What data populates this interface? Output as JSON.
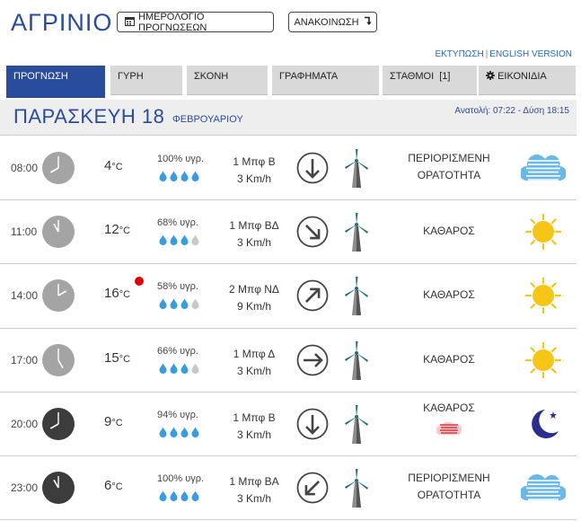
{
  "header": {
    "city": "ΑΓΡΙΝΙΟ",
    "calendar_button": "ΗΜΕΡΟΛΟΓΙΟ ΠΡΟΓΝΩΣΕΩΝ",
    "announcement_button": "ΑΝΑΚΟΙΝΩΣΗ",
    "print_link": "ΕΚΤΥΠΩΣΗ",
    "english_link": "ENGLISH VERSION"
  },
  "tabs": [
    {
      "label": "ΠΡΟΓΝΩΣΗ",
      "active": true
    },
    {
      "label": "ΓΥΡΗ",
      "active": false
    },
    {
      "label": "ΣΚΟΝΗ",
      "active": false
    },
    {
      "label": "ΓΡΑΦΗΜΑΤΑ",
      "active": false
    },
    {
      "label": "ΣΤΑΘΜΟΙ  [1]",
      "active": false
    },
    {
      "label": "ΕΙΚΟΝΙΔΙΑ",
      "active": false
    }
  ],
  "day": {
    "name": "ΠΑΡΑΣΚΕΥΗ 18",
    "month": "ΦΕΒΡΟΥΑΡΙΟΥ",
    "sun": "Ανατολή: 07:22  - Δύση 18:15"
  },
  "forecast": [
    {
      "time": "08:00",
      "temp": "4",
      "humidity": "100% υγρ.",
      "drops_full": 4,
      "wind_bf": "1 Μπφ Β",
      "wind_kmh": "3 Km/h",
      "wind_dir": 180,
      "condition": [
        "ΠΕΡΙΟΡΙΣΜΕΝΗ",
        "ΟΡΑΤΟΤΗΤΑ"
      ],
      "icon": "fog-icon",
      "night": false
    },
    {
      "time": "11:00",
      "temp": "12",
      "humidity": "68% υγρ.",
      "drops_full": 3,
      "wind_bf": "1 Μπφ ΒΔ",
      "wind_kmh": "3 Km/h",
      "wind_dir": 135,
      "condition": [
        "ΚΑΘΑΡΟΣ"
      ],
      "icon": "sun-icon",
      "night": false
    },
    {
      "time": "14:00",
      "temp": "16",
      "humidity": "58% υγρ.",
      "drops_full": 3,
      "wind_bf": "2 Μπφ ΝΔ",
      "wind_kmh": "9 Km/h",
      "wind_dir": 45,
      "condition": [
        "ΚΑΘΑΡΟΣ"
      ],
      "icon": "sun-icon",
      "night": false,
      "max": true
    },
    {
      "time": "17:00",
      "temp": "15",
      "humidity": "66% υγρ.",
      "drops_full": 3,
      "wind_bf": "1 Μπφ Δ",
      "wind_kmh": "3 Km/h",
      "wind_dir": 90,
      "condition": [
        "ΚΑΘΑΡΟΣ"
      ],
      "icon": "sun-icon",
      "night": false
    },
    {
      "time": "20:00",
      "temp": "9",
      "humidity": "94% υγρ.",
      "drops_full": 4,
      "wind_bf": "1 Μπφ Β",
      "wind_kmh": "3 Km/h",
      "wind_dir": 180,
      "condition": [
        "ΚΑΘΑΡΟΣ"
      ],
      "icon": "moon-icon",
      "night": true,
      "haze": true
    },
    {
      "time": "23:00",
      "temp": "6",
      "humidity": "100% υγρ.",
      "drops_full": 4,
      "wind_bf": "1 Μπφ ΒΑ",
      "wind_kmh": "3 Km/h",
      "wind_dir": 225,
      "condition": [
        "ΠΕΡΙΟΡΙΣΜΕΝΗ",
        "ΟΡΑΤΟΤΗΤΑ"
      ],
      "icon": "fog-icon",
      "night": true
    }
  ],
  "units": {
    "temp": "°C"
  },
  "colors": {
    "brand": "#2a4c9c",
    "tab_bg": "#d9d9d9",
    "drop": "#3a9be0",
    "drop_empty": "#c8c8c8",
    "sun": "#f5c518",
    "fog": "#6ab8e6",
    "moon": "#2b2f8c",
    "haze": "#e0353d"
  }
}
